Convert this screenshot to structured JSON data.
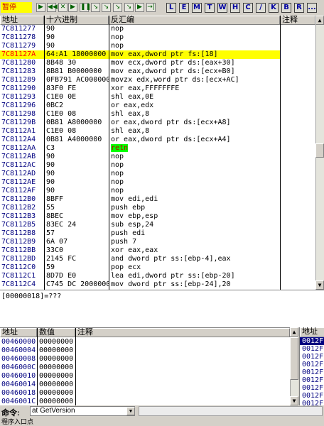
{
  "toolbar": {
    "status": "暂停",
    "buttons": [
      "▶",
      "◀◀",
      "✕",
      "▶",
      "❚❚",
      "↘",
      "↘",
      "↘",
      "↘",
      "▶",
      "→|"
    ],
    "letters": [
      "L",
      "E",
      "M",
      "T",
      "W",
      "H",
      "C",
      "/",
      "K",
      "B",
      "R",
      "..."
    ]
  },
  "disasm": {
    "headers": {
      "address": "地址",
      "hex": "十六进制",
      "disasm": "反汇编",
      "comment": "注释"
    },
    "rows": [
      {
        "address": "7C811277",
        "hex": "90",
        "disasm": "nop",
        "highlight": false,
        "red": false
      },
      {
        "address": "7C811278",
        "hex": "90",
        "disasm": "nop",
        "highlight": false,
        "red": false
      },
      {
        "address": "7C811279",
        "hex": "90",
        "disasm": "nop",
        "highlight": false,
        "red": false
      },
      {
        "address": "7C81127A",
        "hex": "64:A1 18000000",
        "disasm": "mov eax,dword ptr fs:[18]",
        "highlight": true,
        "red": true
      },
      {
        "address": "7C811280",
        "hex": "8B48 30",
        "disasm": "mov ecx,dword ptr ds:[eax+30]",
        "highlight": false,
        "red": false
      },
      {
        "address": "7C811283",
        "hex": "8B81 B0000000",
        "disasm": "mov eax,dword ptr ds:[ecx+B0]",
        "highlight": false,
        "red": false
      },
      {
        "address": "7C811289",
        "hex": "0FB791 AC000000",
        "disasm": "movzx edx,word ptr ds:[ecx+AC]",
        "highlight": false,
        "red": false
      },
      {
        "address": "7C811290",
        "hex": "83F0 FE",
        "disasm": "xor eax,FFFFFFFE",
        "highlight": false,
        "red": false
      },
      {
        "address": "7C811293",
        "hex": "C1E0 0E",
        "disasm": "shl eax,0E",
        "highlight": false,
        "red": false
      },
      {
        "address": "7C811296",
        "hex": "0BC2",
        "disasm": "or eax,edx",
        "highlight": false,
        "red": false
      },
      {
        "address": "7C811298",
        "hex": "C1E0 08",
        "disasm": "shl eax,8",
        "highlight": false,
        "red": false
      },
      {
        "address": "7C81129B",
        "hex": "0B81 A8000000",
        "disasm": "or eax,dword ptr ds:[ecx+A8]",
        "highlight": false,
        "red": false
      },
      {
        "address": "7C8112A1",
        "hex": "C1E0 08",
        "disasm": "shl eax,8",
        "highlight": false,
        "red": false
      },
      {
        "address": "7C8112A4",
        "hex": "0B81 A4000000",
        "disasm": "or eax,dword ptr ds:[ecx+A4]",
        "highlight": false,
        "red": false
      },
      {
        "address": "7C8112AA",
        "hex": "C3",
        "disasm": "retn",
        "highlight": false,
        "red": false,
        "retn": true
      },
      {
        "address": "7C8112AB",
        "hex": "90",
        "disasm": "nop",
        "highlight": false,
        "red": false
      },
      {
        "address": "7C8112AC",
        "hex": "90",
        "disasm": "nop",
        "highlight": false,
        "red": false
      },
      {
        "address": "7C8112AD",
        "hex": "90",
        "disasm": "nop",
        "highlight": false,
        "red": false
      },
      {
        "address": "7C8112AE",
        "hex": "90",
        "disasm": "nop",
        "highlight": false,
        "red": false
      },
      {
        "address": "7C8112AF",
        "hex": "90",
        "disasm": "nop",
        "highlight": false,
        "red": false
      },
      {
        "address": "7C8112B0",
        "hex": "8BFF",
        "disasm": "mov edi,edi",
        "highlight": false,
        "red": false
      },
      {
        "address": "7C8112B2",
        "hex": "55",
        "disasm": "push ebp",
        "highlight": false,
        "red": false
      },
      {
        "address": "7C8112B3",
        "hex": "8BEC",
        "disasm": "mov ebp,esp",
        "highlight": false,
        "red": false
      },
      {
        "address": "7C8112B5",
        "hex": "83EC 24",
        "disasm": "sub esp,24",
        "highlight": false,
        "red": false
      },
      {
        "address": "7C8112B8",
        "hex": "57",
        "disasm": "push edi",
        "highlight": false,
        "red": false
      },
      {
        "address": "7C8112B9",
        "hex": "6A 07",
        "disasm": "push 7",
        "highlight": false,
        "red": false
      },
      {
        "address": "7C8112BB",
        "hex": "33C0",
        "disasm": "xor eax,eax",
        "highlight": false,
        "red": false
      },
      {
        "address": "7C8112BD",
        "hex": "2145 FC",
        "disasm": "and dword ptr ss:[ebp-4],eax",
        "highlight": false,
        "red": false
      },
      {
        "address": "7C8112C0",
        "hex": "59",
        "disasm": "pop ecx",
        "highlight": false,
        "red": false
      },
      {
        "address": "7C8112C1",
        "hex": "8D7D E0",
        "disasm": "lea edi,dword ptr ss:[ebp-20]",
        "highlight": false,
        "red": false
      },
      {
        "address": "7C8112C4",
        "hex": "C745 DC 2000000",
        "disasm": "mov dword ptr ss:[ebp-24],20",
        "highlight": false,
        "red": false
      }
    ]
  },
  "info": {
    "text": "[00000018]=???"
  },
  "dump": {
    "headers": {
      "address": "地址",
      "value": "数值",
      "comment": "注释"
    },
    "rows": [
      {
        "address": "00460000",
        "value": "00000000"
      },
      {
        "address": "00460004",
        "value": "00000000"
      },
      {
        "address": "00460008",
        "value": "00000000"
      },
      {
        "address": "0046000C",
        "value": "00000000"
      },
      {
        "address": "00460010",
        "value": "00000000"
      },
      {
        "address": "00460014",
        "value": "00000000"
      },
      {
        "address": "00460018",
        "value": "00000000"
      },
      {
        "address": "0046001C",
        "value": "00000000"
      }
    ]
  },
  "stack": {
    "header": "地址",
    "rows": [
      "0012F",
      "0012F",
      "0012F",
      "0012F",
      "0012F",
      "0012F",
      "0012F",
      "0012F",
      "0012F",
      "0012F"
    ]
  },
  "command": {
    "label": "命令:",
    "value": "at GetVersion"
  },
  "statusbar": {
    "text": "程序入口点"
  },
  "colors": {
    "highlight_row": "#ffff00",
    "red_address": "#ff0000",
    "retn_bg": "#00ff00",
    "address_text": "#000080",
    "stack_selected": "#000080"
  }
}
